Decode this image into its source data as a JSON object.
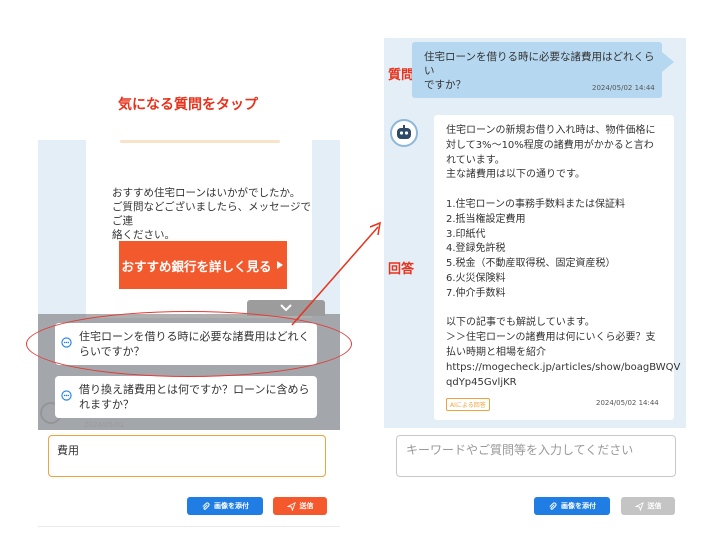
{
  "left": {
    "caption": "気になる質問をタップ",
    "intro_lines": [
      "おすすめ住宅ローンはいかがでしたか。",
      "ご質問などございましたら、メッセージでご連",
      "絡ください。"
    ],
    "cta_label": "おすすめ銀行を詳しく見る",
    "collapse_icon": "chevron-down-icon",
    "questions": [
      {
        "line1": "住宅ローンを借りる時に必要な諸費用はどれく",
        "line2": "らいですか？"
      },
      {
        "line1": "借り換え諸費用とは何ですか？ローンに含めら",
        "line2": "れますか？"
      }
    ],
    "faint_time": "2024/05/02",
    "input_value": "費用",
    "attach_label": "画像を添付",
    "send_label": "送信"
  },
  "right": {
    "label_question": "質問",
    "label_answer": "回答",
    "user_message_lines": [
      "住宅ローンを借りる時に必要な諸費用はどれくらい",
      "ですか？"
    ],
    "user_time": "2024/05/02 14:44",
    "answer_lines": [
      "住宅ローンの新規お借り入れ時は、物件価格に",
      "対して3%～10%程度の諸費用がかかると言わ",
      "れています。",
      "主な諸費用は以下の通りです。",
      "",
      "1.住宅ローンの事務手数料または保証料",
      "2.抵当権設定費用",
      "3.印紙代",
      "4.登録免許税",
      "5.税金（不動産取得税、固定資産税）",
      "6.火災保険料",
      "7.仲介手数料",
      "",
      "以下の記事でも解説しています。",
      "＞＞住宅ローンの諸費用は何にいくら必要？支",
      "払い時期と相場を紹介",
      "https://mogecheck.jp/articles/show/boagBWQV",
      "qdYp45GvljKR"
    ],
    "ai_badge": "AIによる回答",
    "answer_time": "2024/05/02 14:44",
    "input_placeholder": "キーワードやご質問等を入力してください",
    "attach_label": "画像を添付",
    "send_label": "送信"
  },
  "colors": {
    "accent_red": "#e8321c",
    "cta_orange": "#f25a2e",
    "attach_blue": "#1f7de3",
    "panel_bg": "#e4eef7",
    "user_bubble": "#b5d7ef"
  }
}
